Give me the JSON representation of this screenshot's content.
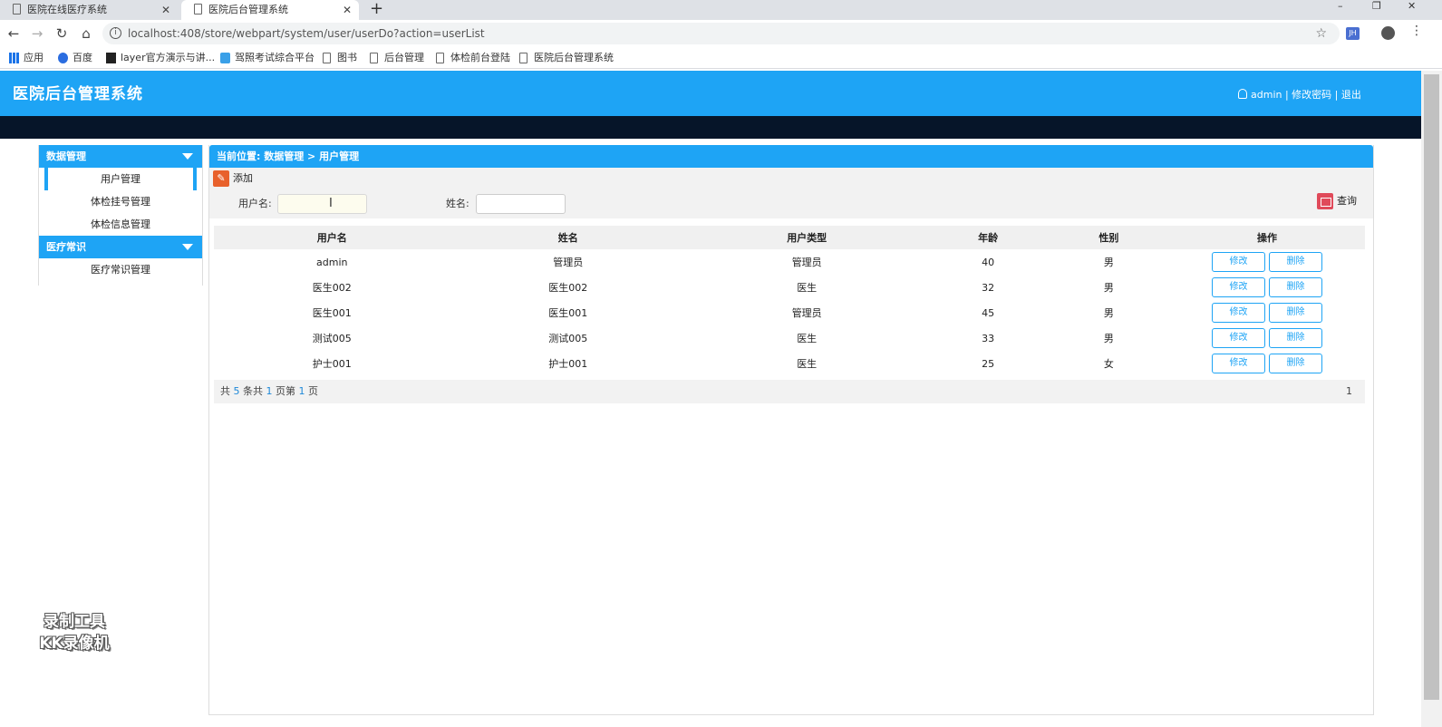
{
  "browser": {
    "tabs": [
      {
        "title": "医院在线医疗系统",
        "active": false
      },
      {
        "title": "医院后台管理系统",
        "active": true
      }
    ],
    "new_tab": "+",
    "window_controls": {
      "minimize": "–",
      "restore": "❐",
      "close": "✕"
    },
    "url": "localhost:408/store/webpart/system/user/userDo?action=userList",
    "extension_badge": "JH",
    "bookmarks": [
      {
        "label": "应用",
        "icon": "apps-icon"
      },
      {
        "label": "百度",
        "icon": "baidu-paw-icon"
      },
      {
        "label": "layer官方演示与讲...",
        "icon": "layer-icon"
      },
      {
        "label": "驾照考试综合平台",
        "icon": "smart-icon"
      },
      {
        "label": "图书",
        "icon": "page-icon"
      },
      {
        "label": "后台管理",
        "icon": "page-icon"
      },
      {
        "label": "体检前台登陆",
        "icon": "page-icon"
      },
      {
        "label": "医院后台管理系统",
        "icon": "page-icon"
      }
    ]
  },
  "header": {
    "title": "医院后台管理系统",
    "user": "admin",
    "sep1": " | ",
    "change_password": "修改密码",
    "sep2": " | ",
    "logout": "退出"
  },
  "sidebar": {
    "groups": [
      {
        "title": "数据管理",
        "items": [
          "用户管理",
          "体检挂号管理",
          "体检信息管理"
        ]
      },
      {
        "title": "医疗常识",
        "items": [
          "医疗常识管理"
        ]
      }
    ],
    "active_item": "用户管理"
  },
  "main": {
    "breadcrumb": "当前位置: 数据管理 > 用户管理",
    "add_label": "添加",
    "search": {
      "username_label": "用户名:",
      "username_value": "",
      "name_label": "姓名:",
      "name_value": "",
      "query_label": "查询"
    },
    "table": {
      "columns": [
        "用户名",
        "姓名",
        "用户类型",
        "年龄",
        "性别",
        "操作"
      ],
      "rows": [
        [
          "admin",
          "管理员",
          "管理员",
          "40",
          "男"
        ],
        [
          "医生002",
          "医生002",
          "医生",
          "32",
          "男"
        ],
        [
          "医生001",
          "医生001",
          "管理员",
          "45",
          "男"
        ],
        [
          "测试005",
          "测试005",
          "医生",
          "33",
          "男"
        ],
        [
          "护士001",
          "护士001",
          "医生",
          "25",
          "女"
        ]
      ],
      "edit_label": "修改",
      "delete_label": "删除"
    },
    "pager": {
      "prefix": "共",
      "total": "5",
      "mid1": "条共",
      "pages": "1",
      "mid2": "页第",
      "current": "1",
      "suffix": "页",
      "page_link": "1"
    }
  },
  "watermark": {
    "line1": "录制工具",
    "line2": "KK录像机"
  },
  "colors": {
    "primary": "#1ea4f5",
    "dark_bar": "#061529",
    "add_icon": "#e8612c",
    "query_icon": "#e04a5a"
  }
}
